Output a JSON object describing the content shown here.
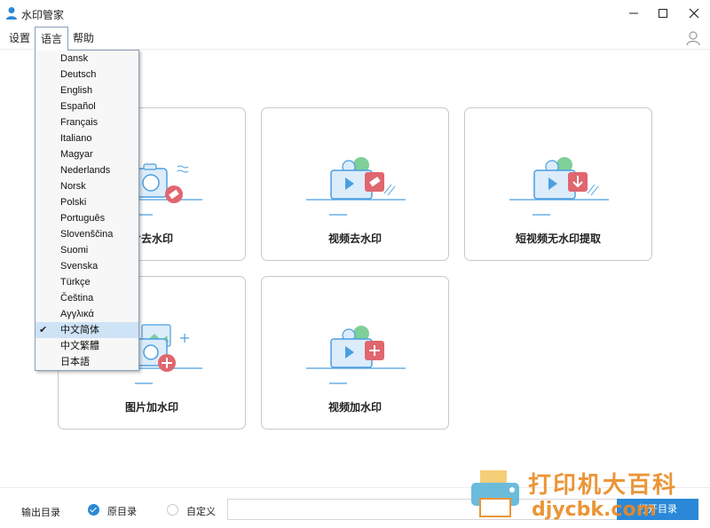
{
  "window": {
    "title": "水印管家"
  },
  "menu": {
    "settings": "设置",
    "language": "语言",
    "help": "帮助"
  },
  "languages": [
    "Dansk",
    "Deutsch",
    "English",
    "Español",
    "Français",
    "Italiano",
    "Magyar",
    "Nederlands",
    "Norsk",
    "Polski",
    "Português",
    "Slovenščina",
    "Suomi",
    "Svenska",
    "Türkçe",
    "Čeština",
    "Αγγλικά",
    "中文简体",
    "中文繁體",
    "日本語"
  ],
  "selected_language": "中文简体",
  "cards": [
    {
      "label": "片去水印",
      "icon": "camera-erase-icon"
    },
    {
      "label": "视频去水印",
      "icon": "video-erase-icon"
    },
    {
      "label": "短视频无水印提取",
      "icon": "video-download-icon"
    },
    {
      "label": "图片加水印",
      "icon": "image-add-icon"
    },
    {
      "label": "视频加水印",
      "icon": "video-add-icon"
    }
  ],
  "footer": {
    "output_label": "输出目录",
    "original_dir": "原目录",
    "custom": "自定义",
    "path_value": "",
    "open_button": "打开目录"
  },
  "watermark": {
    "text": "打印机大百科",
    "url": "djycbk.com"
  },
  "colors": {
    "accent": "#2b88d8",
    "card_border": "#c8c8c8",
    "icon_blue": "#4a9fe0",
    "icon_red": "#e0666f",
    "icon_green": "#7fcf98"
  }
}
